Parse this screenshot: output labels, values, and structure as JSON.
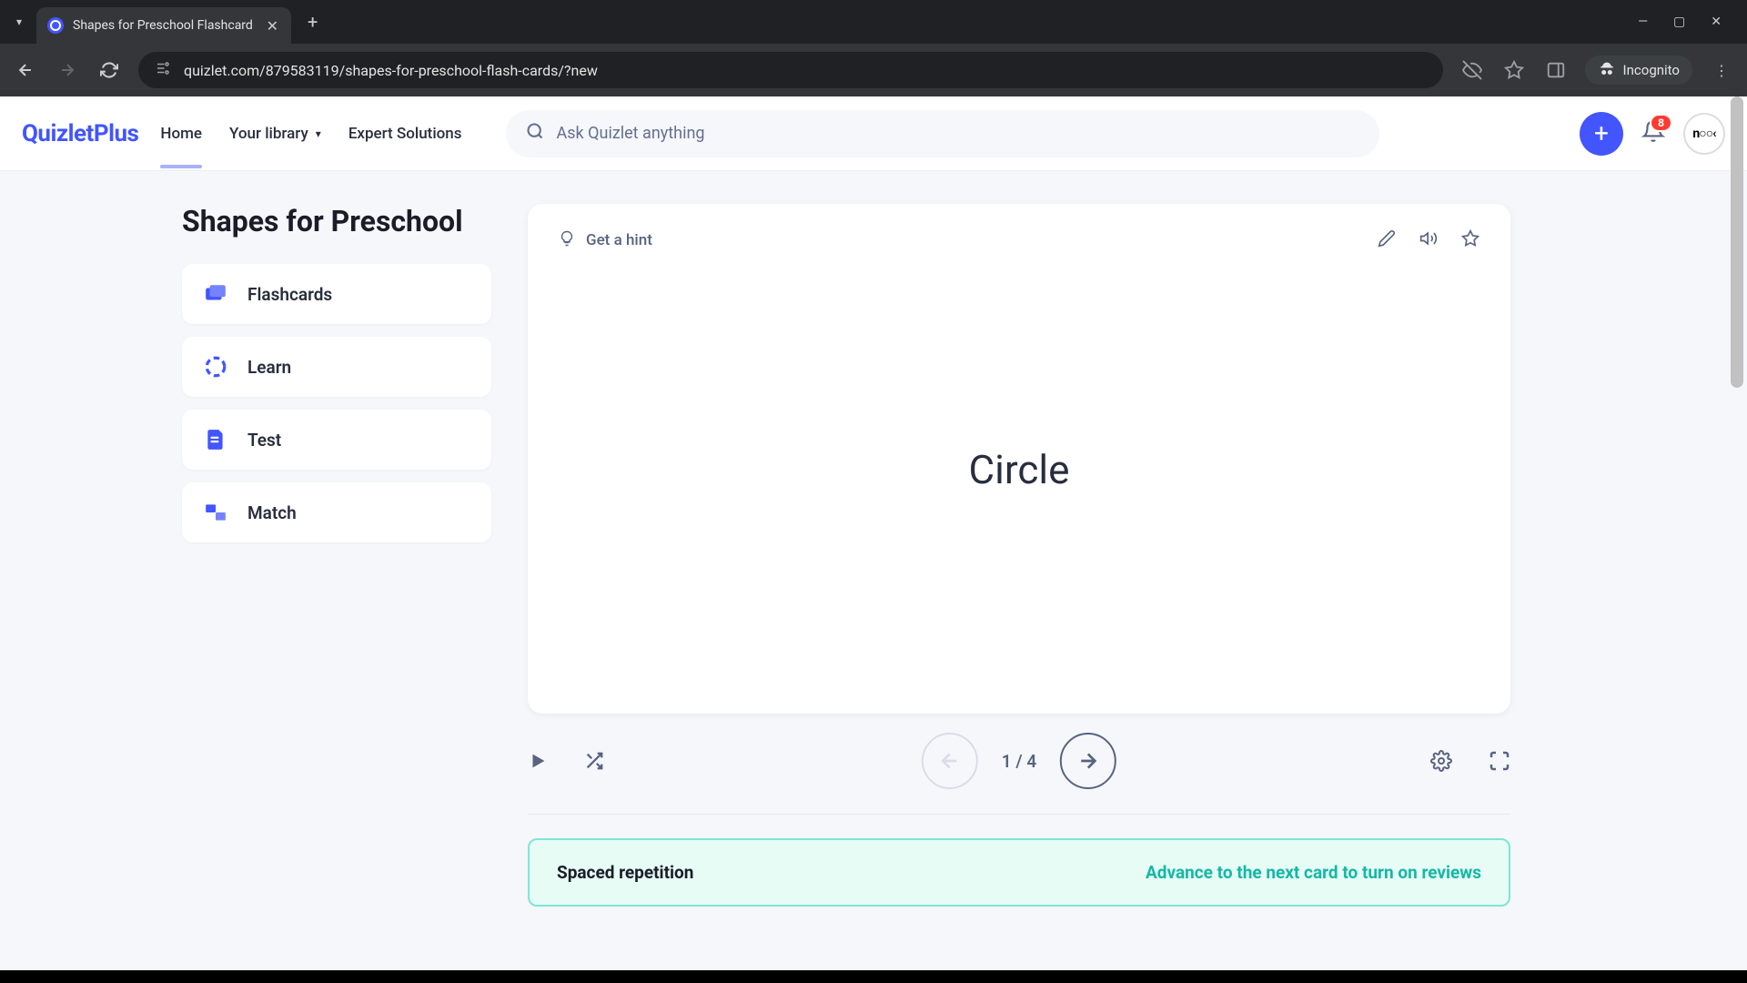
{
  "browser": {
    "tab_title": "Shapes for Preschool Flashcard",
    "url": "quizlet.com/879583119/shapes-for-preschool-flash-cards/?new",
    "incognito_label": "Incognito"
  },
  "header": {
    "logo_main": "Quizlet",
    "logo_suffix": "Plus",
    "nav": {
      "home": "Home",
      "library": "Your library",
      "expert": "Expert Solutions"
    },
    "search_placeholder": "Ask Quizlet anything",
    "badge_count": "8",
    "avatar_text": "n○○‹"
  },
  "set": {
    "title": "Shapes for Preschool",
    "modes": [
      {
        "label": "Flashcards"
      },
      {
        "label": "Learn"
      },
      {
        "label": "Test"
      },
      {
        "label": "Match"
      }
    ]
  },
  "card": {
    "hint_label": "Get a hint",
    "term": "Circle",
    "progress": "1 / 4"
  },
  "banner": {
    "title": "Spaced repetition",
    "cta": "Advance to the next card to turn on reviews"
  }
}
